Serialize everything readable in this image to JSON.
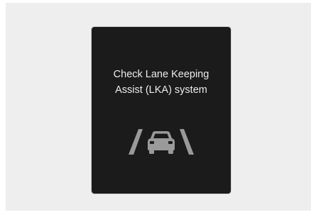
{
  "warning": {
    "message_line1": "Check Lane Keeping",
    "message_line2": "Assist (LKA) system",
    "icon": "lane-keeping-assist-icon",
    "background_color": "#1b1b1b",
    "text_color": "#ececec",
    "icon_color": "#9a9a9a"
  }
}
